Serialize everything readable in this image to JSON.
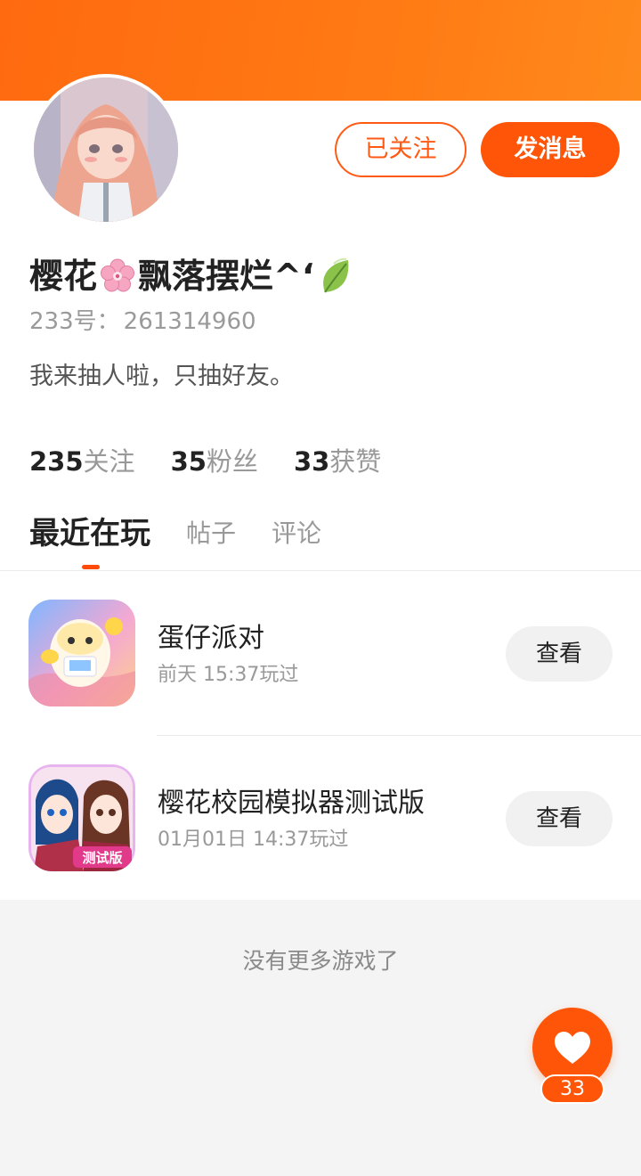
{
  "profile": {
    "name_part1": "樱花",
    "name_part2": "飘落摆烂^‘",
    "uid_label": "233号",
    "uid_sep": "：",
    "uid_value": "261314960",
    "bio": "我来抽人啦，只抽好友。",
    "followed_label": "已关注",
    "message_label": "发消息"
  },
  "stats": [
    {
      "num": "235",
      "label": "关注"
    },
    {
      "num": "35",
      "label": "粉丝"
    },
    {
      "num": "33",
      "label": "获赞"
    }
  ],
  "tabs": [
    {
      "label": "最近在玩",
      "active": true
    },
    {
      "label": "帖子",
      "active": false
    },
    {
      "label": "评论",
      "active": false
    }
  ],
  "games": [
    {
      "name": "蛋仔派对",
      "time": "前天 15:37玩过",
      "button": "查看"
    },
    {
      "name": "樱花校园模拟器测试版",
      "time": "01月01日 14:37玩过",
      "button": "查看"
    }
  ],
  "no_more": "没有更多游戏了",
  "like_count": "33",
  "colors": {
    "accent": "#ff5508",
    "header_gradient_start": "#ff6a10",
    "header_gradient_end": "#ff8a1c"
  },
  "icons": {
    "flower": "cherry-blossom-emoji",
    "leaf": "leaf-emoji",
    "like": "heart-icon"
  }
}
